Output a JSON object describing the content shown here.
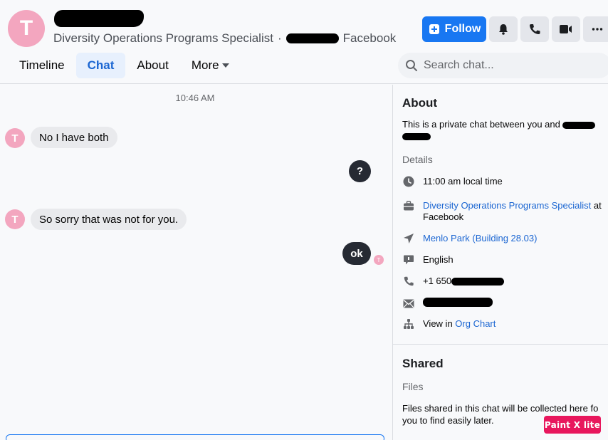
{
  "header": {
    "avatar_initial": "T",
    "subtitle_role": "Diversity Operations Programs Specialist",
    "subtitle_sep": "·",
    "subtitle_company": "Facebook",
    "follow_label": "Follow",
    "icons": [
      "bell-icon",
      "phone-icon",
      "video-icon",
      "more-icon"
    ]
  },
  "tabs": [
    {
      "label": "Timeline",
      "active": false
    },
    {
      "label": "Chat",
      "active": true
    },
    {
      "label": "About",
      "active": false
    },
    {
      "label": "More",
      "active": false
    }
  ],
  "search": {
    "placeholder": "Search chat..."
  },
  "chat": {
    "timestamp": "10:46 AM",
    "messages": [
      {
        "from": "them",
        "avatar": "T",
        "text": "No I have both"
      },
      {
        "from": "me",
        "text": "?"
      },
      {
        "from": "them",
        "avatar": "T",
        "text": "So sorry that was not for you."
      },
      {
        "from": "me",
        "text": "ok",
        "receipt": "T"
      }
    ]
  },
  "panel": {
    "about_title": "About",
    "about_text": "This is a private chat between you and",
    "details_label": "Details",
    "local_time": "11:00 am local time",
    "role_link": "Diversity Operations Programs Specialist",
    "role_at": " at",
    "role_company": "Facebook",
    "location": "Menlo Park (Building 28.03)",
    "language": "English",
    "phone_prefix": "+1 650",
    "org_prefix": "View in ",
    "org_link": "Org Chart",
    "shared_title": "Shared",
    "files_label": "Files",
    "files_text_1": "Files shared in this chat will be collected here fo",
    "files_text_2": "you to find easily later."
  },
  "watermark": "Paint X lite",
  "colors": {
    "accent": "#1877f2",
    "avatar": "#f3a6bf",
    "bubble_out": "#262a33",
    "link": "#1b66d2"
  }
}
